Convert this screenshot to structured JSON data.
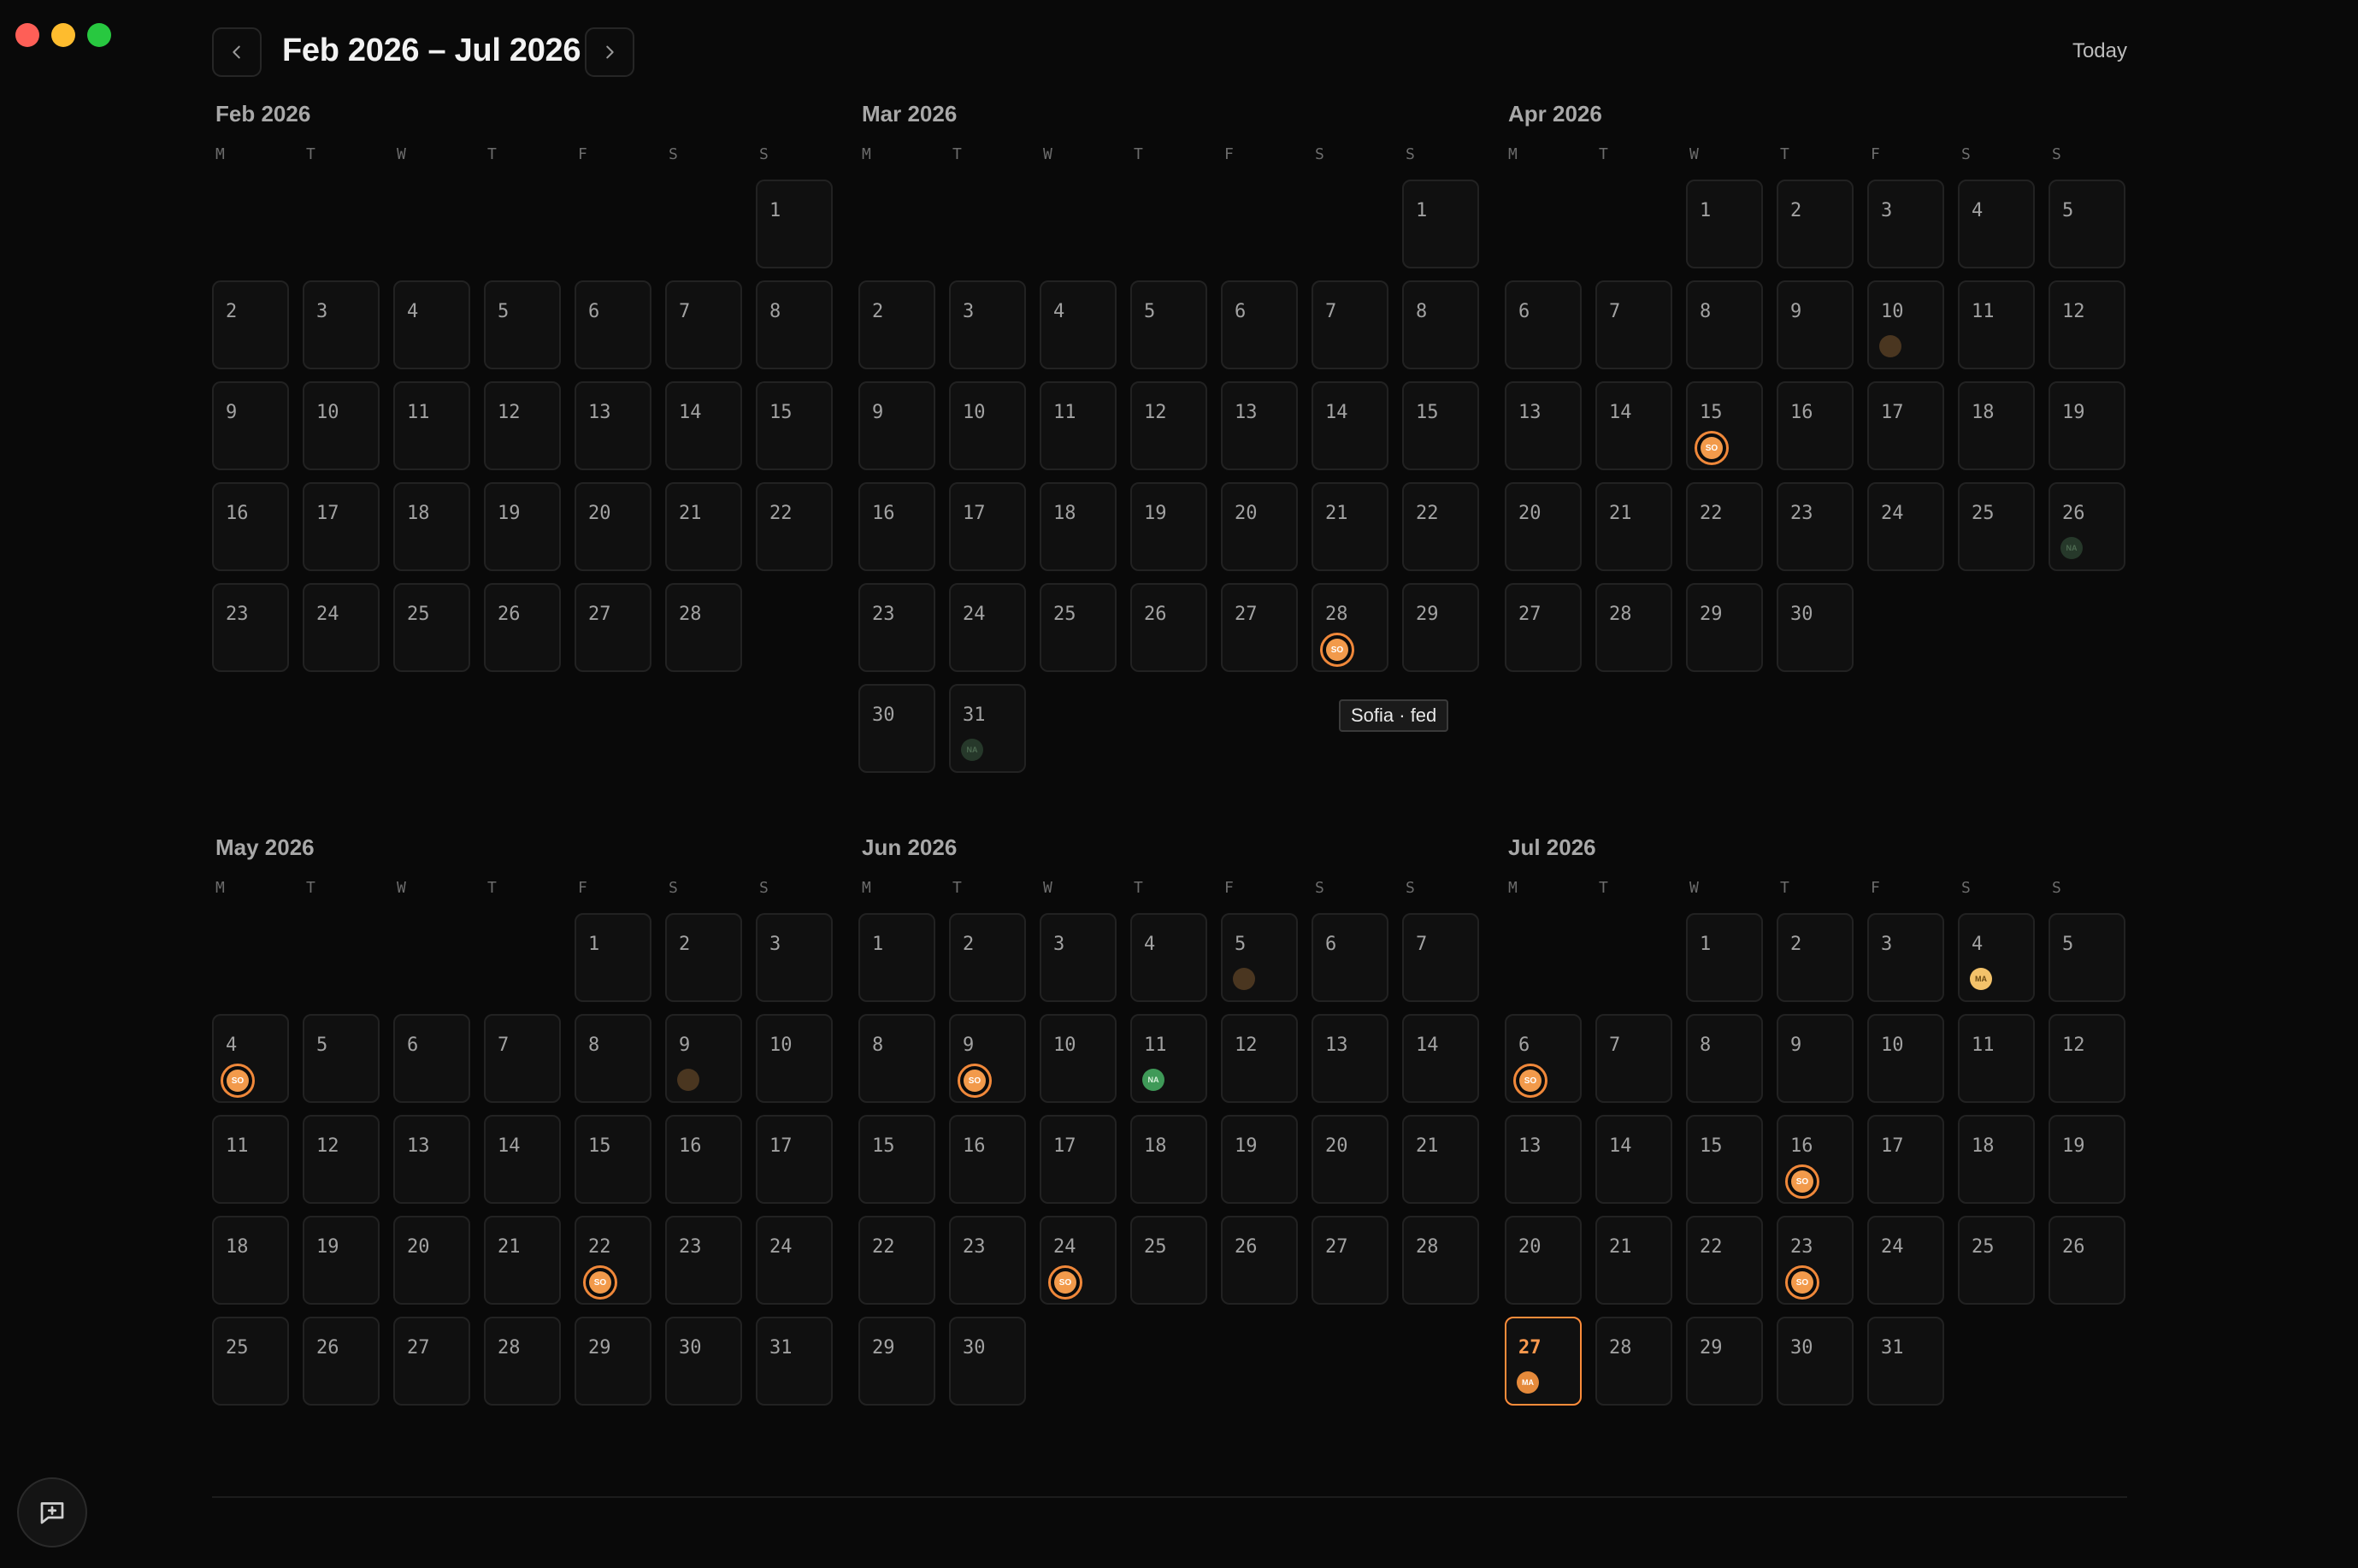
{
  "header": {
    "title": "Feb 2026 – Jul 2026",
    "today_label": "Today",
    "prev_icon": "chevron-left-icon",
    "next_icon": "chevron-right-icon"
  },
  "weekdays": [
    "M",
    "T",
    "W",
    "T",
    "F",
    "S",
    "S"
  ],
  "tooltip": "Sofia · fed",
  "months": [
    {
      "title": "Feb 2026",
      "offset": 6,
      "days": 28,
      "events": {}
    },
    {
      "title": "Mar 2026",
      "offset": 6,
      "days": 31,
      "events": {
        "28": {
          "initials": "SO",
          "style": "big"
        },
        "31": {
          "initials": "NA",
          "style": "green-dim"
        }
      }
    },
    {
      "title": "Apr 2026",
      "offset": 2,
      "days": 30,
      "events": {
        "10": {
          "initials": "",
          "style": "brown-dim"
        },
        "15": {
          "initials": "SO",
          "style": "big"
        },
        "26": {
          "initials": "NA",
          "style": "green-dim"
        }
      }
    },
    {
      "title": "May 2026",
      "offset": 4,
      "days": 31,
      "events": {
        "4": {
          "initials": "SO",
          "style": "big"
        },
        "9": {
          "initials": "",
          "style": "brown-dim"
        },
        "22": {
          "initials": "SO",
          "style": "big"
        }
      }
    },
    {
      "title": "Jun 2026",
      "offset": 0,
      "days": 30,
      "events": {
        "5": {
          "initials": "",
          "style": "brown-dim"
        },
        "9": {
          "initials": "SO",
          "style": "big"
        },
        "11": {
          "initials": "NA",
          "style": "green"
        },
        "24": {
          "initials": "SO",
          "style": "big"
        }
      }
    },
    {
      "title": "Jul 2026",
      "offset": 2,
      "days": 31,
      "today": 27,
      "events": {
        "4": {
          "initials": "MA",
          "style": "yellow"
        },
        "6": {
          "initials": "SO",
          "style": "big"
        },
        "16": {
          "initials": "SO",
          "style": "big"
        },
        "23": {
          "initials": "SO",
          "style": "big"
        },
        "27": {
          "initials": "MA",
          "style": "orange-small"
        }
      }
    }
  ],
  "colors": {
    "accent": "#ff8c3a",
    "background": "#090909",
    "cell_bg": "#101010"
  }
}
